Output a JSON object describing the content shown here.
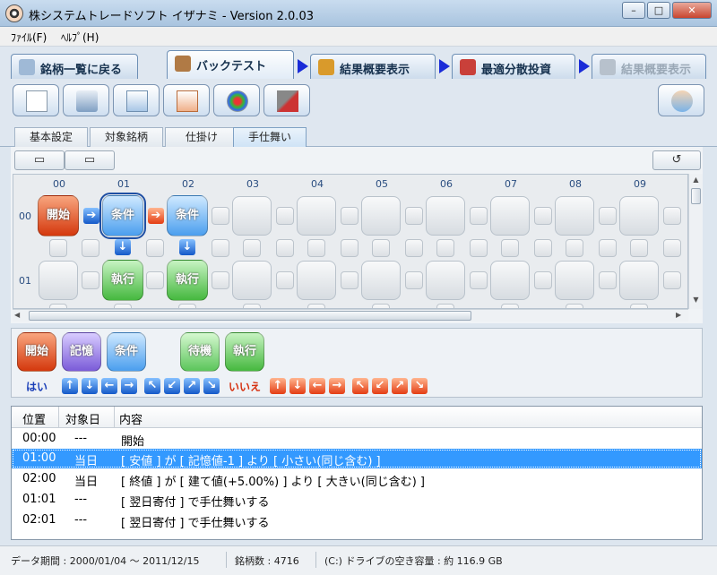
{
  "window": {
    "title": "株システムトレードソフト イザナミ - Version 2.0.03",
    "min": "–",
    "max": "□",
    "close": "✕"
  },
  "menu": [
    {
      "label": "ﾌｧｲﾙ(F)"
    },
    {
      "label": "ﾍﾙﾌﾟ(H)"
    }
  ],
  "top_tabs": [
    {
      "label": "銘柄一覧に戻る",
      "icon": "eye-icon"
    },
    {
      "label": "バックテスト",
      "icon": "bag-icon"
    },
    {
      "label": "結果概要表示",
      "icon": "money-icon"
    },
    {
      "label": "最適分散投資",
      "icon": "calculator-icon"
    },
    {
      "label": "結果概要表示",
      "icon": "building-icon"
    }
  ],
  "sub_tabs": [
    "基本設定",
    "対象銘柄",
    "仕掛け",
    "手仕舞い"
  ],
  "grid": {
    "columns": [
      "00",
      "01",
      "02",
      "03",
      "04",
      "05",
      "06",
      "07",
      "08",
      "09"
    ],
    "rows": [
      "00",
      "01"
    ],
    "nodes": {
      "start": "開始",
      "cond1": "条件",
      "cond2": "条件",
      "exec1": "執行",
      "exec2": "執行"
    },
    "arrows": {
      "right": "➔",
      "down": "↓"
    }
  },
  "palette": {
    "blocks": [
      "開始",
      "記憶",
      "条件",
      "待機",
      "執行"
    ],
    "yes_label": "はい",
    "no_label": "いいえ",
    "yes_arrows": [
      "↑",
      "↓",
      "←",
      "→",
      "↖",
      "↙",
      "↗",
      "↘"
    ],
    "no_arrows": [
      "↑",
      "↓",
      "←",
      "→",
      "↖",
      "↙",
      "↗",
      "↘"
    ]
  },
  "table": {
    "headers": [
      "位置",
      "対象日",
      "内容"
    ],
    "rows": [
      {
        "pos": "00:00",
        "day": "---",
        "content": "開始"
      },
      {
        "pos": "01:00",
        "day": "当日",
        "content": "[ 安値 ] が [ 記憶値-1 ] より [ 小さい(同じ含む) ]"
      },
      {
        "pos": "02:00",
        "day": "当日",
        "content": "[ 終値 ] が [ 建て値(+5.00%) ] より [ 大きい(同じ含む) ]"
      },
      {
        "pos": "01:01",
        "day": "---",
        "content": "[ 翌日寄付 ] で手仕舞いする"
      },
      {
        "pos": "02:01",
        "day": "---",
        "content": "[ 翌日寄付 ] で手仕舞いする"
      }
    ],
    "selected_index": 1
  },
  "status": {
    "period": "データ期間 : 2000/01/04 ～ 2011/12/15",
    "count": "銘柄数 : 4716",
    "disk": "(C:) ドライブの空き容量 : 約 116.9 GB"
  },
  "colors": {
    "accent": "#3399ff",
    "start": "#d4380d",
    "cond": "#4a9eee",
    "exec": "#45b83e"
  }
}
